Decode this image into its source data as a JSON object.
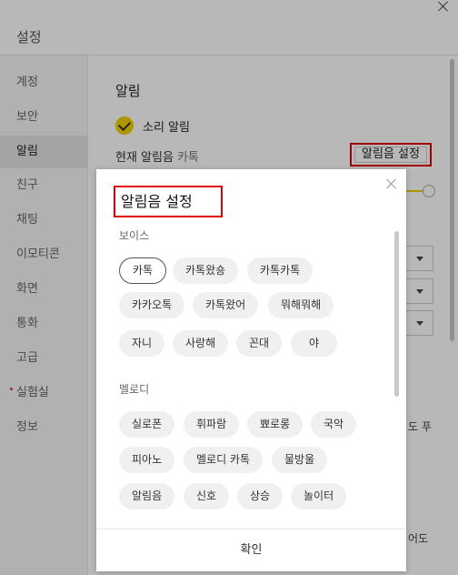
{
  "window": {
    "title": "설정"
  },
  "sidebar": {
    "items": [
      {
        "label": "계정"
      },
      {
        "label": "보안"
      },
      {
        "label": "알림"
      },
      {
        "label": "친구"
      },
      {
        "label": "채팅"
      },
      {
        "label": "이모티콘"
      },
      {
        "label": "화면"
      },
      {
        "label": "통화"
      },
      {
        "label": "고급"
      },
      {
        "label": "실험실"
      },
      {
        "label": "정보"
      }
    ],
    "active_index": 2
  },
  "notification": {
    "section_title": "알림",
    "sound_toggle_label": "소리 알림",
    "sound_toggle_checked": true,
    "current_sound_label": "현재 알림음",
    "current_sound_value": "카톡",
    "sound_setting_button": "알림음 설정",
    "side_text_1": "도 푸",
    "side_text_2": "어도"
  },
  "modal": {
    "title": "알림음 설정",
    "voice_label": "보이스",
    "voice_chips": [
      "카톡",
      "카톡왔숑",
      "카톡카톡",
      "카카오톡",
      "카톡왔어",
      "뭐해뭐해",
      "자니",
      "사랑해",
      "꼰대",
      "야"
    ],
    "selected_chip": "카톡",
    "melody_label": "멜로디",
    "melody_chips": [
      "실로폰",
      "휘파람",
      "뾰로롱",
      "국악",
      "피아노",
      "멜로디 카톡",
      "물방울",
      "알림음",
      "신호",
      "상승",
      "놀이터"
    ],
    "confirm_label": "확인"
  },
  "colors": {
    "accent": "#f3d000",
    "highlight_border": "#e00000"
  }
}
